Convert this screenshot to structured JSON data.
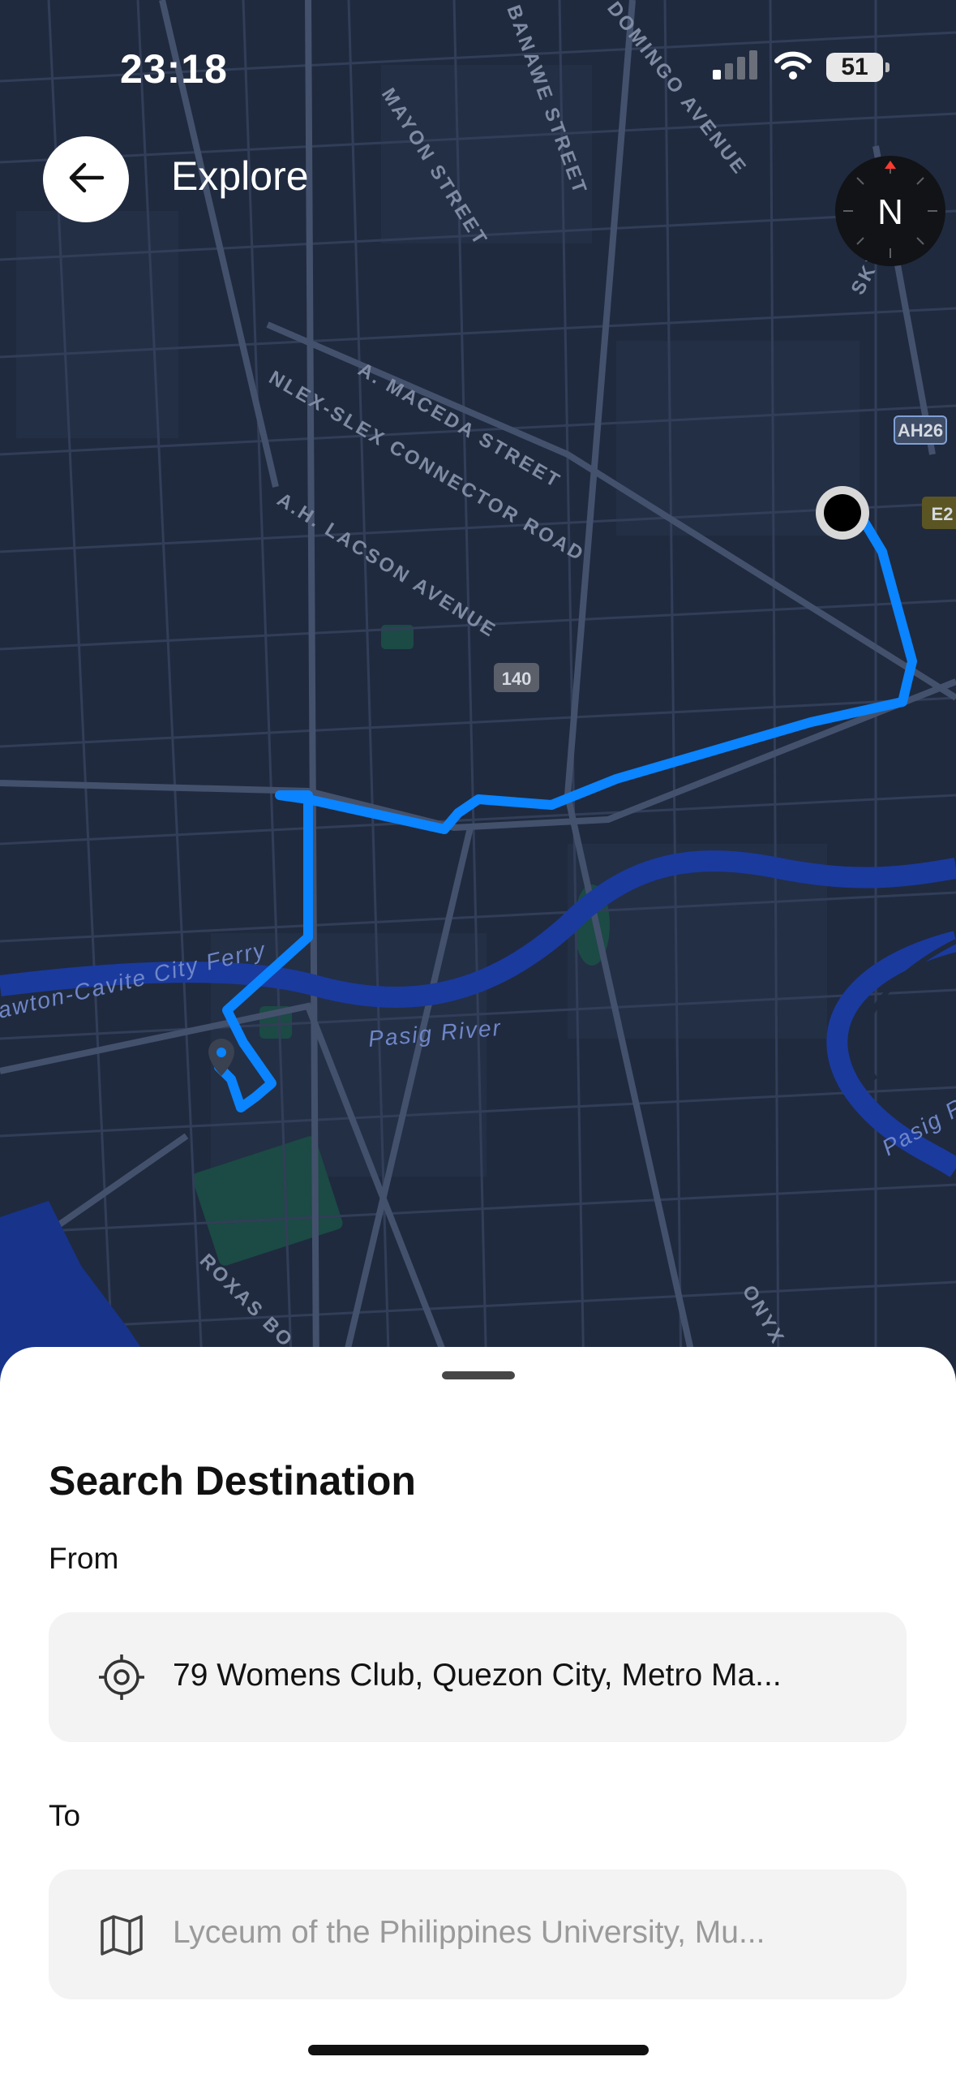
{
  "status_bar": {
    "time": "23:18",
    "battery": "51",
    "icons": [
      "signal-icon",
      "wifi-icon",
      "battery-icon"
    ]
  },
  "header": {
    "title": "Explore",
    "back_icon": "arrow-left-icon",
    "compass_label": "N"
  },
  "map": {
    "street_labels": [
      "BANAWE STREET",
      "DOMINGO AVENUE",
      "MAYON STREET",
      "SKYWAY",
      "NLEX-SLEX CONNECTOR ROAD",
      "A. MACEDA STREET",
      "A.H. LACSON AVENUE",
      "ROXAS BO",
      "ONYX ST"
    ],
    "water_labels": [
      "Pasig River",
      "Pasig Ri",
      "awton-Cavite City Ferry"
    ],
    "shields": [
      "AH26",
      "E2",
      "140"
    ],
    "colors": {
      "background": "#1f2a3e",
      "route": "#0a84ff",
      "water": "#1a3a9e",
      "park": "#1c4a45"
    }
  },
  "sheet": {
    "title": "Search Destination",
    "from": {
      "label": "From",
      "value": "79 Womens Club, Quezon City, Metro Ma...",
      "icon": "location-target-icon"
    },
    "to": {
      "label": "To",
      "placeholder": "Lyceum of the Philippines University, Mu...",
      "icon": "map-icon"
    }
  }
}
